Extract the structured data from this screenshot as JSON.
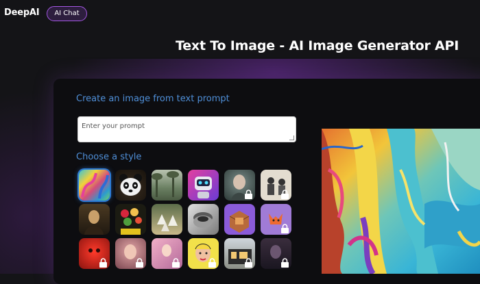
{
  "header": {
    "logo": "DeepAI",
    "chat_button": "AI Chat"
  },
  "page_title": "Text To Image - AI Image Generator API",
  "create_label": "Create an image from text prompt",
  "prompt": {
    "placeholder": "Enter your prompt",
    "value": ""
  },
  "style_label": "Choose a style",
  "styles": [
    {
      "name": "abstract-painting",
      "selected": true,
      "locked": false
    },
    {
      "name": "panda",
      "selected": false,
      "locked": false
    },
    {
      "name": "misty-landscape",
      "selected": false,
      "locked": false
    },
    {
      "name": "robot",
      "selected": false,
      "locked": false
    },
    {
      "name": "portrait-woman",
      "selected": false,
      "locked": true
    },
    {
      "name": "vintage-sketch",
      "selected": false,
      "locked": true
    },
    {
      "name": "classic-portrait",
      "selected": false,
      "locked": false
    },
    {
      "name": "flower-bouquet",
      "selected": false,
      "locked": false
    },
    {
      "name": "ballet-dancers",
      "selected": false,
      "locked": false
    },
    {
      "name": "metal-object",
      "selected": false,
      "locked": false
    },
    {
      "name": "isometric-room",
      "selected": false,
      "locked": false
    },
    {
      "name": "fox-character",
      "selected": false,
      "locked": true
    },
    {
      "name": "red-creature",
      "selected": false,
      "locked": true
    },
    {
      "name": "soft-portrait",
      "selected": false,
      "locked": true
    },
    {
      "name": "pink-figure",
      "selected": false,
      "locked": true
    },
    {
      "name": "pop-art-face",
      "selected": false,
      "locked": true
    },
    {
      "name": "modern-house",
      "selected": false,
      "locked": true
    },
    {
      "name": "dark-figure",
      "selected": false,
      "locked": true
    }
  ],
  "colors": {
    "accent_border": "#a557e4",
    "label_blue": "#4f8fd8",
    "selected_glow": "#2c7bd6",
    "background": "#141417",
    "panel": "#0d0d10"
  }
}
